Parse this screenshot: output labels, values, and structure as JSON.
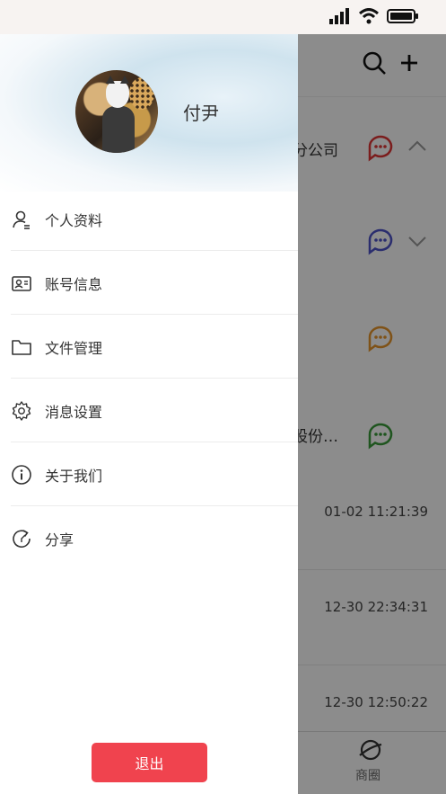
{
  "colors": {
    "accent_red": "#f0434e",
    "chat_red": "#e03535",
    "chat_blue": "#4e52c9",
    "chat_orange": "#e8962a",
    "chat_green": "#3a9c3a"
  },
  "status_bar": {
    "icons": [
      "signal-icon",
      "wifi-icon",
      "battery-icon"
    ]
  },
  "drawer": {
    "user_name": "付尹",
    "menu": [
      {
        "label": "个人资料",
        "icon": "user-icon"
      },
      {
        "label": "账号信息",
        "icon": "id-card-icon"
      },
      {
        "label": "文件管理",
        "icon": "folder-icon"
      },
      {
        "label": "消息设置",
        "icon": "gear-icon"
      },
      {
        "label": "关于我们",
        "icon": "info-icon"
      },
      {
        "label": "分享",
        "icon": "share-icon"
      }
    ],
    "logout_label": "退出"
  },
  "background": {
    "header_icons": [
      "search-icon",
      "plus-icon"
    ],
    "rows": [
      {
        "name": "分公司",
        "chat_icon": "chat-icon",
        "chevron": "chevron-up-icon"
      },
      {
        "name": "",
        "chat_icon": "chat-icon",
        "chevron": "chevron-down-icon"
      },
      {
        "name": "",
        "chat_icon": "chat-icon",
        "chevron": ""
      },
      {
        "name": "股份…",
        "chat_icon": "chat-icon",
        "chevron": ""
      }
    ],
    "list_times": [
      "01-02 11:21:39",
      "12-30 22:34:31",
      "12-30 12:50:22"
    ],
    "tab_label": "商圈",
    "tab_icon": "planet-icon"
  }
}
